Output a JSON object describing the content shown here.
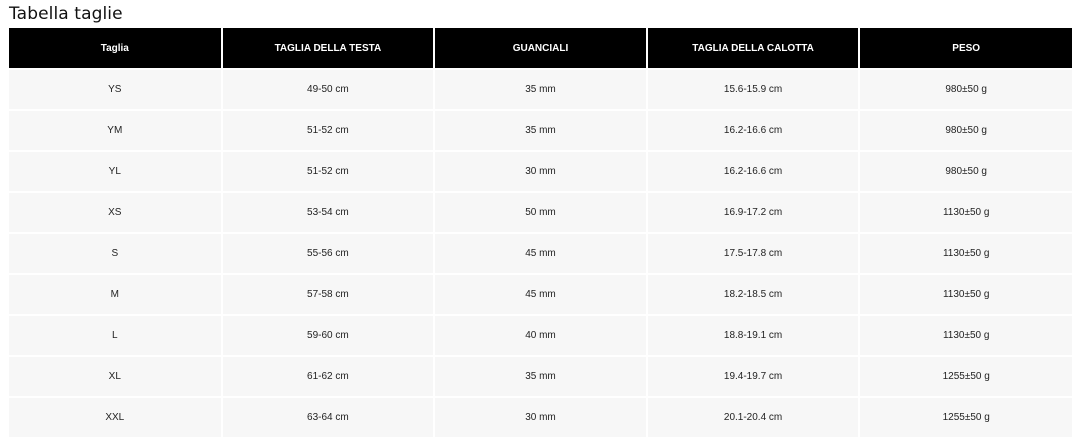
{
  "title": "Tabella taglie",
  "table": {
    "headers": [
      "Taglia",
      "TAGLIA DELLA TESTA",
      "GUANCIALI",
      "TAGLIA DELLA CALOTTA",
      "PESO"
    ],
    "rows": [
      [
        "YS",
        "49-50 cm",
        "35 mm",
        "15.6-15.9 cm",
        "980±50 g"
      ],
      [
        "YM",
        "51-52 cm",
        "35 mm",
        "16.2-16.6 cm",
        "980±50 g"
      ],
      [
        "YL",
        "51-52 cm",
        "30 mm",
        "16.2-16.6 cm",
        "980±50 g"
      ],
      [
        "XS",
        "53-54 cm",
        "50 mm",
        "16.9-17.2 cm",
        "1130±50 g"
      ],
      [
        "S",
        "55-56 cm",
        "45 mm",
        "17.5-17.8 cm",
        "1130±50 g"
      ],
      [
        "M",
        "57-58 cm",
        "45 mm",
        "18.2-18.5 cm",
        "1130±50 g"
      ],
      [
        "L",
        "59-60 cm",
        "40 mm",
        "18.8-19.1 cm",
        "1130±50 g"
      ],
      [
        "XL",
        "61-62 cm",
        "35 mm",
        "19.4-19.7 cm",
        "1255±50 g"
      ],
      [
        "XXL",
        "63-64 cm",
        "30 mm",
        "20.1-20.4 cm",
        "1255±50 g"
      ]
    ]
  },
  "colors": {
    "header_bg": "#000000",
    "header_text": "#ffffff",
    "cell_bg": "#f7f7f7"
  }
}
